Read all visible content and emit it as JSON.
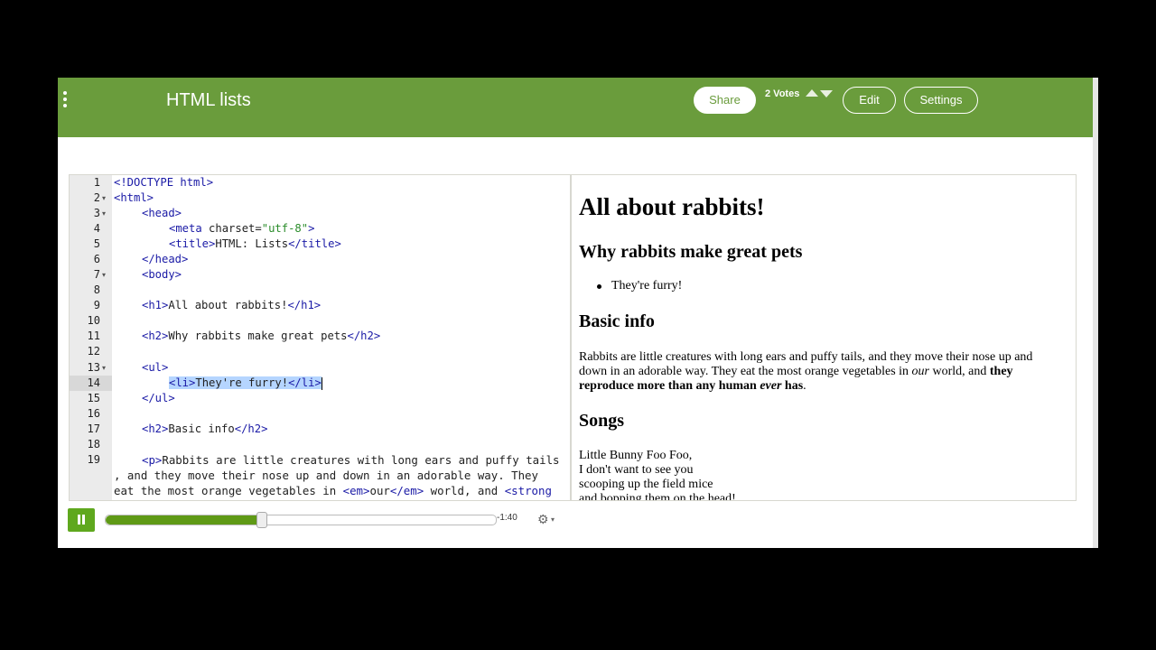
{
  "header": {
    "title": "HTML lists",
    "share_label": "Share",
    "votes_label": "2 Votes",
    "edit_label": "Edit",
    "settings_label": "Settings"
  },
  "editor": {
    "lines": [
      {
        "n": "1",
        "fold": false
      },
      {
        "n": "2",
        "fold": true
      },
      {
        "n": "3",
        "fold": true
      },
      {
        "n": "4",
        "fold": false
      },
      {
        "n": "5",
        "fold": false
      },
      {
        "n": "6",
        "fold": false
      },
      {
        "n": "7",
        "fold": true
      },
      {
        "n": "8",
        "fold": false
      },
      {
        "n": "9",
        "fold": false
      },
      {
        "n": "10",
        "fold": false
      },
      {
        "n": "11",
        "fold": false
      },
      {
        "n": "12",
        "fold": false
      },
      {
        "n": "13",
        "fold": true
      },
      {
        "n": "14",
        "fold": false
      },
      {
        "n": "15",
        "fold": false
      },
      {
        "n": "16",
        "fold": false
      },
      {
        "n": "17",
        "fold": false
      },
      {
        "n": "18",
        "fold": false
      },
      {
        "n": "19",
        "fold": false
      }
    ],
    "code": {
      "l1": "<!DOCTYPE html>",
      "l2": "<html>",
      "l3": "<head>",
      "l4_tag": "<meta",
      "l4_attr": " charset=",
      "l4_str": "\"utf-8\"",
      "l4_end": ">",
      "l5_open": "<title>",
      "l5_text": "HTML: Lists",
      "l5_close": "</title>",
      "l6": "</head>",
      "l7": "<body>",
      "l9_open": "<h1>",
      "l9_text": "All about rabbits!",
      "l9_close": "</h1>",
      "l11_open": "<h2>",
      "l11_text": "Why rabbits make great pets",
      "l11_close": "</h2>",
      "l13": "<ul>",
      "l14_open": "<li>",
      "l14_text": "They're furry!",
      "l14_close": "</li>",
      "l15": "</ul>",
      "l17_open": "<h2>",
      "l17_text": "Basic info",
      "l17_close": "</h2>",
      "l19_open": "<p>",
      "l19_text": "Rabbits are little creatures with long ears and puffy tails",
      "l19b_text": ", and they move their nose up and down in an adorable way. They",
      "l19c_text": "eat the most orange vegetables in ",
      "l19c_em_open": "<em>",
      "l19c_em_text": "our",
      "l19c_em_close": "</em>",
      "l19c_text2": " world, and ",
      "l19c_strong": "<strong"
    }
  },
  "preview": {
    "h1": "All about rabbits!",
    "h2_pets": "Why rabbits make great pets",
    "li": "They're furry!",
    "h2_info": "Basic info",
    "p1_a": "Rabbits are little creatures with long ears and puffy tails, and they move their nose up and down in an adorable way. They eat the most orange vegetables in ",
    "p1_em": "our",
    "p1_b": " world, and ",
    "p1_strong_a": "they reproduce more than any human ",
    "p1_strong_em": "ever",
    "p1_strong_b": " has",
    "p1_end": ".",
    "h2_songs": "Songs",
    "song_1": "Little Bunny Foo Foo,",
    "song_2": "I don't want to see you",
    "song_3": "scooping up the field mice",
    "song_4": "and bopping them on the head!"
  },
  "player": {
    "time_remaining": "-1:40",
    "progress": 0.4
  },
  "icons": {
    "menu": "menu-dots-icon",
    "vote_up": "triangle-up-icon",
    "vote_down": "triangle-down-icon",
    "pause": "pause-icon",
    "gear": "gear-icon"
  },
  "colors": {
    "header_bg": "#6a9c3c",
    "play_button": "#5fa81e",
    "progress_fill": "#5f9a16",
    "tag_color": "#1a1aa6",
    "string_color": "#2a8c2a",
    "selection": "#b5d5ff"
  }
}
